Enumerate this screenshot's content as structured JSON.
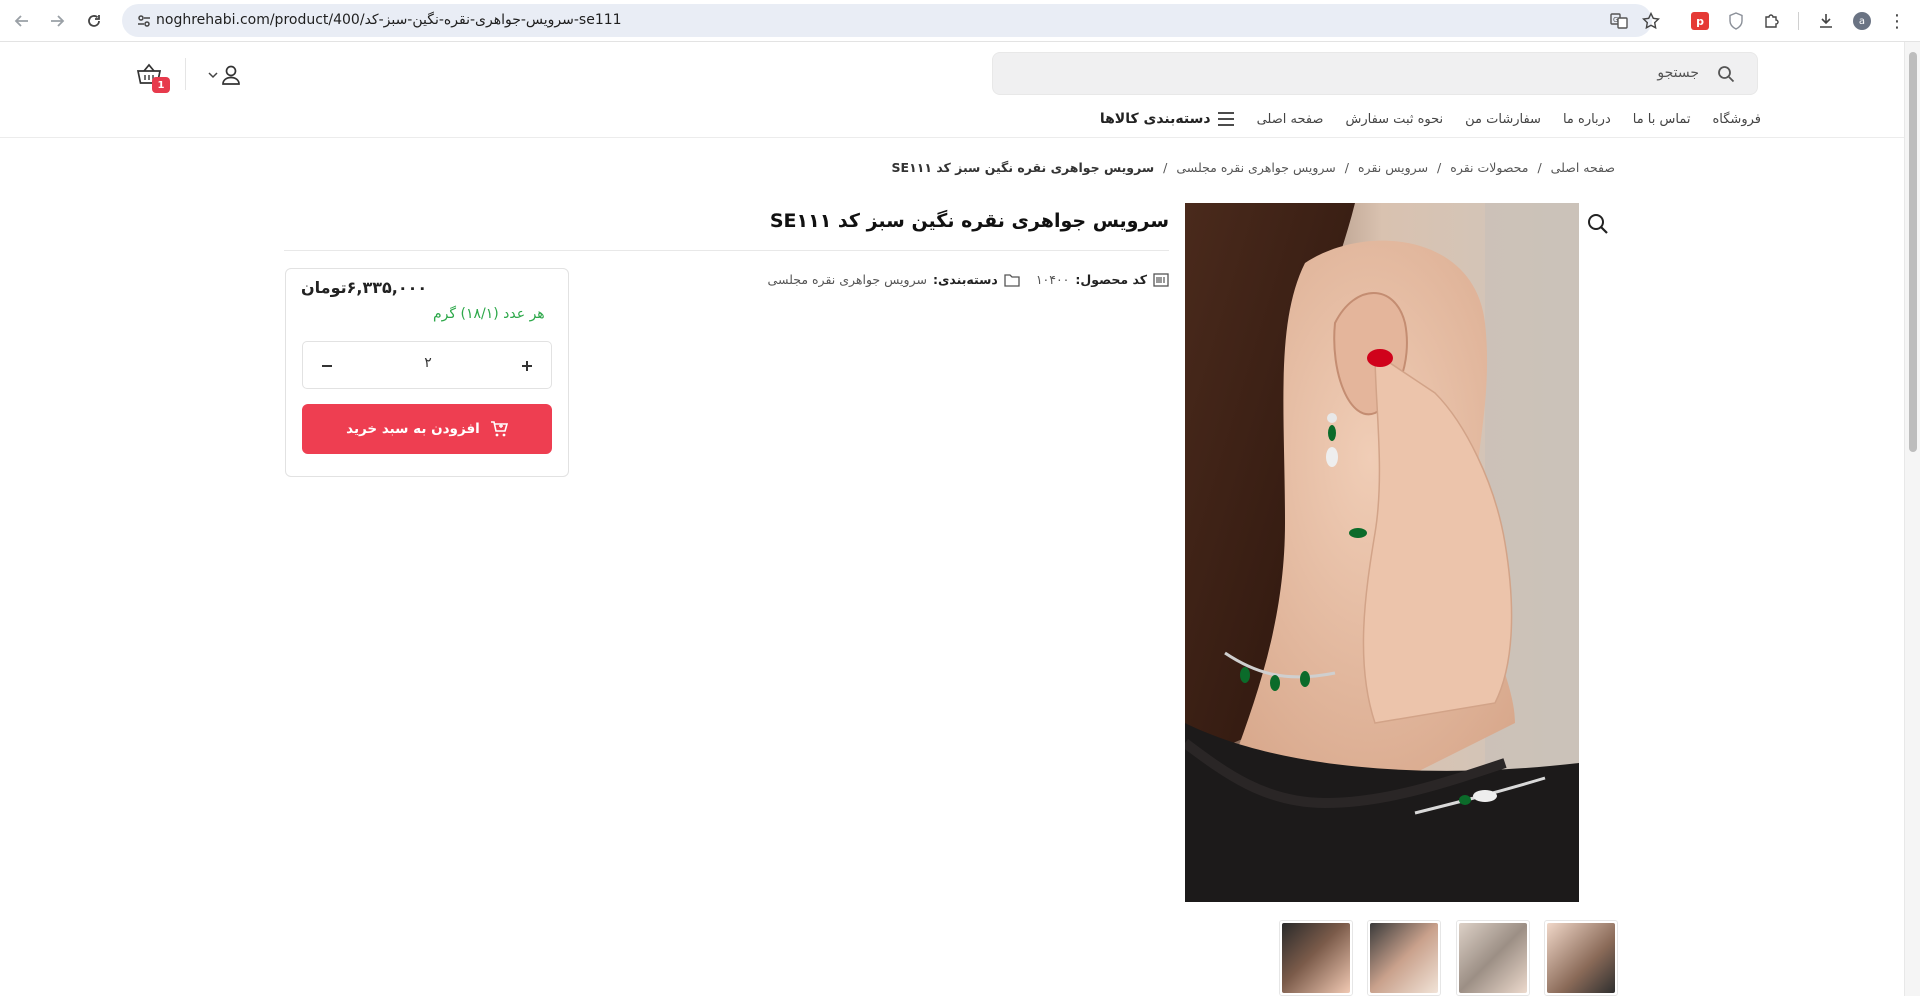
{
  "browser": {
    "url": "noghrehabi.com/product/400/سرویس-جواهری-نقره-نگین-سبز-کد-se111",
    "back_icon": "arrow-left-icon",
    "forward_icon": "arrow-right-icon",
    "reload_icon": "reload-icon",
    "profile_initial": "a"
  },
  "header": {
    "search_placeholder": "جستجو",
    "cart_count": "1"
  },
  "menu": {
    "categories_label": "دسته‌بندی کالاها",
    "items": [
      "صفحه اصلی",
      "نحوه ثبت سفارش",
      "سفارشات من",
      "درباره ما",
      "تماس با ما",
      "فروشگاه"
    ]
  },
  "breadcrumb": {
    "items": [
      "صفحه اصلی",
      "محصولات نقره",
      "سرویس نقره",
      "سرویس جواهری نقره مجلسی"
    ],
    "separator": "/",
    "current": "سرویس جواهری نقره نگین سبز کد SE۱۱۱"
  },
  "product": {
    "title": "سرویس جواهری نقره نگین سبز کد SE۱۱۱",
    "code_label": "کد محصول:",
    "code_value": "۱۰۴۰۰",
    "category_label": "دسته‌بندی:",
    "category_value": "سرویس جواهری نقره مجلسی",
    "price": "۶,۳۳۵,۰۰۰",
    "currency": "تومان",
    "weight_text": "هر عدد (۱۸/۱) گرم",
    "quantity": "۲",
    "add_to_cart_label": "افزودن به سبد خرید"
  },
  "colors": {
    "accent": "#ee3e51",
    "weight_green": "#2da84a"
  }
}
